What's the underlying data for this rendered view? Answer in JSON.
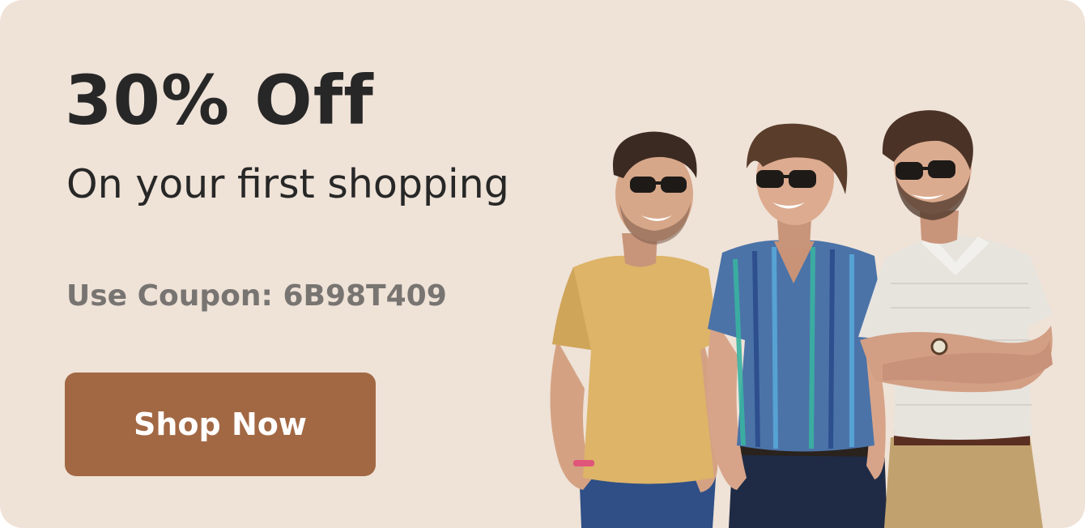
{
  "promo": {
    "headline": "30% Off",
    "subheadline": "On your first shopping",
    "coupon_text": "Use Coupon: 6B98T409",
    "cta_label": "Shop Now"
  },
  "colors": {
    "background": "#efe2d7",
    "headline": "#272727",
    "coupon": "#777471",
    "button": "#a26843",
    "button_text": "#ffffff"
  },
  "photo": {
    "subject": "three-smiling-men-in-sunglasses"
  }
}
